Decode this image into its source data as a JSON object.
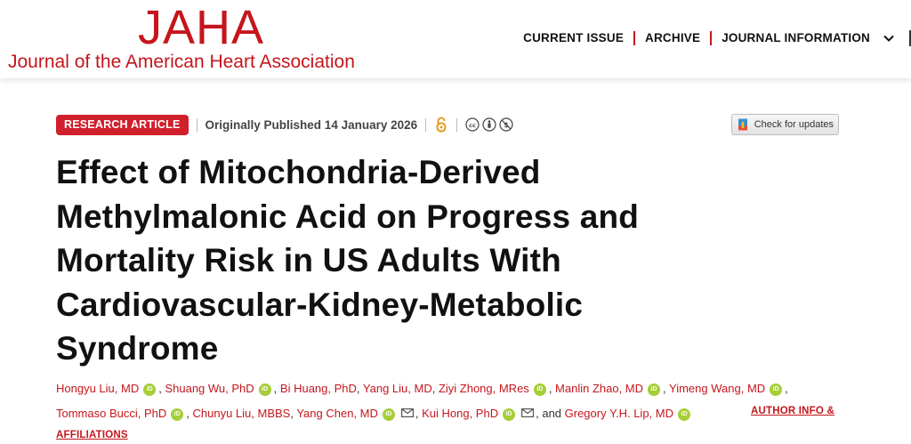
{
  "header": {
    "logo_abbrev": "JAHA",
    "logo_full": "Journal of the American Heart Association",
    "nav": [
      "CURRENT ISSUE",
      "ARCHIVE",
      "JOURNAL INFORMATION"
    ]
  },
  "article": {
    "badge": "RESEARCH ARTICLE",
    "published": "Originally Published 14 January 2026",
    "check_updates": "Check for updates",
    "title": "Effect of Mitochondria‐Derived Methylmalonic Acid on Progress and Mortality Risk in US Adults With Cardiovascular‐Kidney‐Metabolic Syndrome",
    "authors_line1": [
      {
        "name": "Hongyu Liu, MD",
        "orcid": true,
        "sep": ", "
      },
      {
        "name": "Shuang Wu, PhD",
        "orcid": true,
        "sep": ", "
      },
      {
        "name": "Bi Huang, PhD",
        "orcid": false,
        "sep": ", "
      },
      {
        "name": "Yang Liu, MD",
        "orcid": false,
        "sep": ", "
      },
      {
        "name": "Ziyi Zhong, MRes",
        "orcid": true,
        "sep": ", "
      },
      {
        "name": "Manlin Zhao, MD",
        "orcid": true,
        "sep": ", "
      },
      {
        "name": "Yimeng Wang, MD",
        "orcid": true,
        "sep": ","
      }
    ],
    "authors_line2": [
      {
        "name": "Tommaso Bucci, PhD",
        "orcid": true,
        "sep": ", "
      },
      {
        "name": "Chunyu Liu, MBBS",
        "orcid": false,
        "sep": ", "
      },
      {
        "name": "Yang Chen, MD",
        "orcid": true,
        "mail": true,
        "sep": ", "
      },
      {
        "name": "Kui Hong, PhD",
        "orcid": true,
        "mail": true,
        "sep": ", and "
      },
      {
        "name": "Gregory Y.H. Lip, MD",
        "orcid": true,
        "sep": ""
      }
    ],
    "author_info": "AUTHOR INFO &",
    "affiliations": "AFFILIATIONS"
  },
  "colors": {
    "brand_red": "#c4161c",
    "orcid_green": "#a6ce39"
  },
  "icons": [
    "open-access-icon",
    "cc-icon",
    "by-icon",
    "nc-icon",
    "chevron-down-icon",
    "orcid-icon",
    "email-icon"
  ]
}
